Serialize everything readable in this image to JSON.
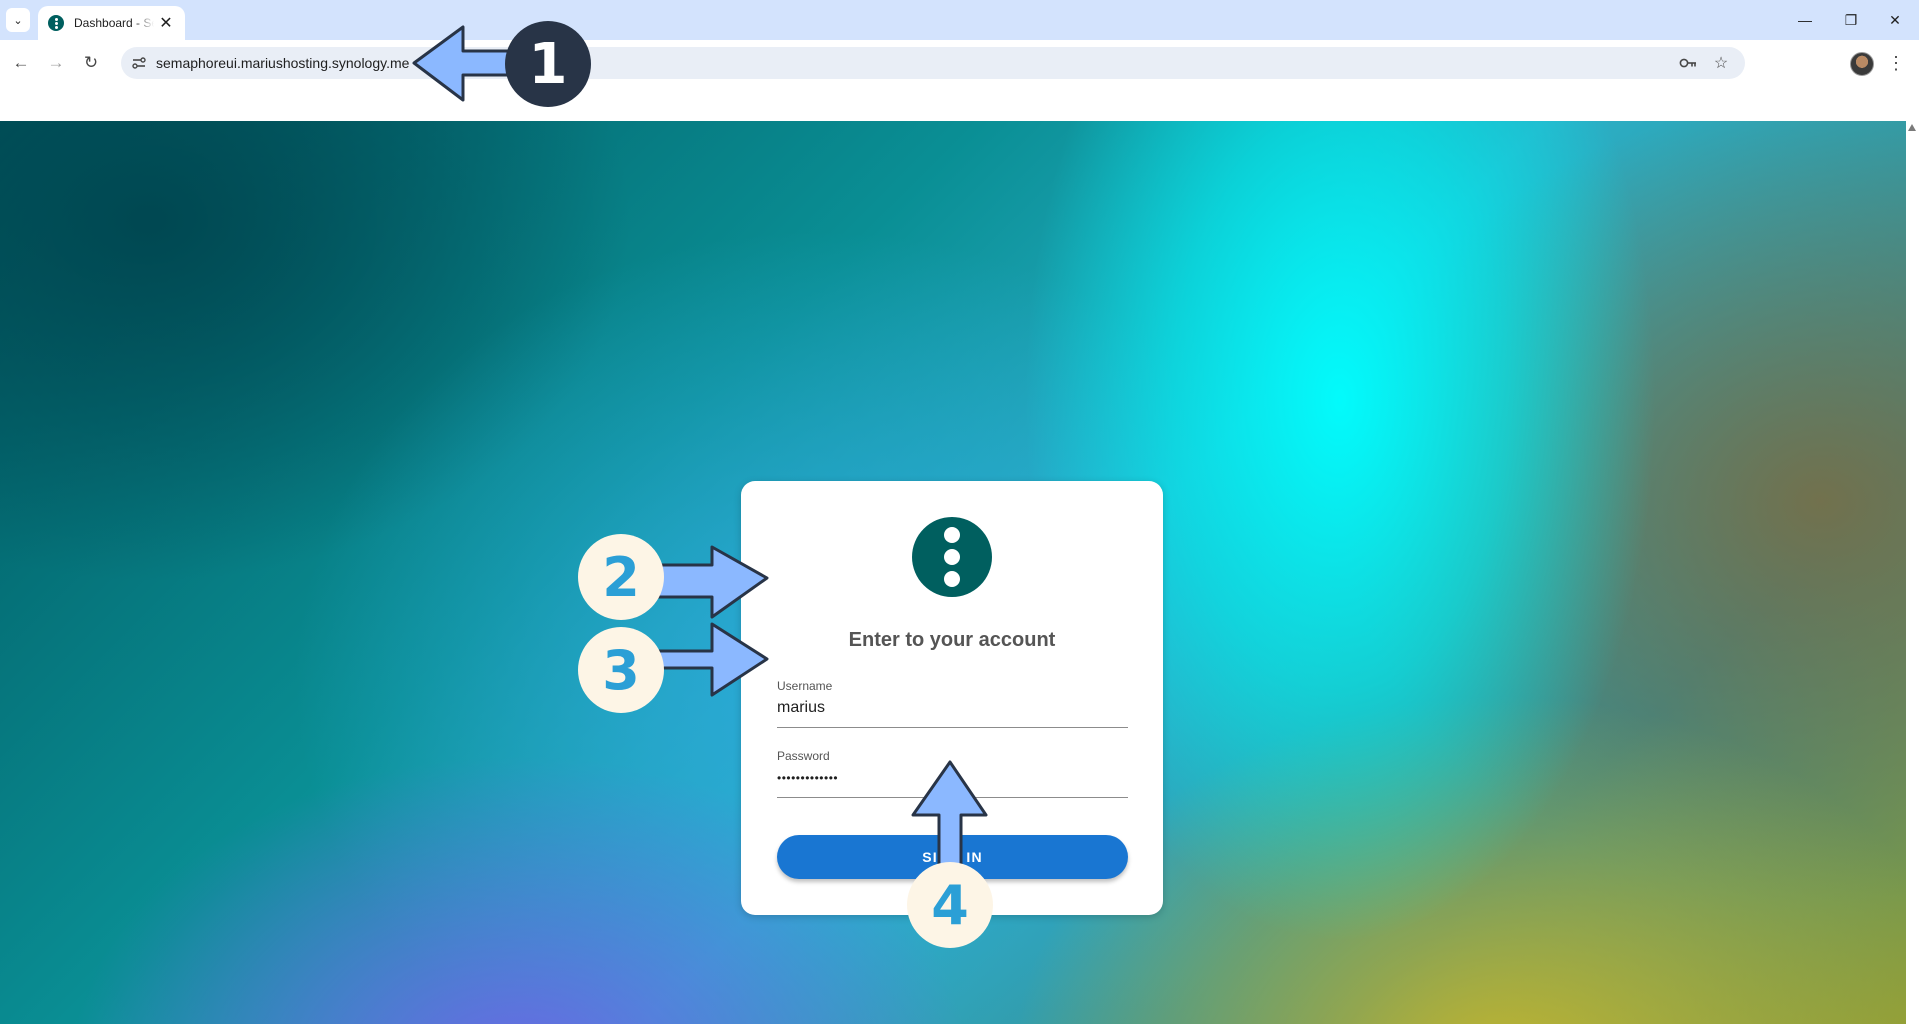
{
  "browser": {
    "tab_title": "Dashboard - Semaphore UI",
    "tab_close": "✕",
    "url": "semaphoreui.mariushosting.synology.me",
    "window_controls": {
      "minimize": "—",
      "restore": "❐",
      "close": "✕"
    },
    "nav": {
      "back": "←",
      "forward": "→",
      "reload": "↻",
      "menu": "⋮"
    },
    "omnibox_icons": {
      "key": "key-icon",
      "star": "☆"
    }
  },
  "login": {
    "title": "Enter to your account",
    "username_label": "Username",
    "username_value": "marius",
    "password_label": "Password",
    "password_value": "•••••••••••••",
    "sign_in_label": "SIGN IN"
  },
  "callouts": {
    "one": "1",
    "two": "2",
    "three": "3",
    "four": "4"
  },
  "colors": {
    "logo": "#005f5f",
    "primary_button": "#1976d2",
    "arrow_fill": "#8bb8ff",
    "callout_dark": "#283447",
    "callout_light": "#fdf5e6",
    "callout_digit": "#2b9fd6"
  }
}
